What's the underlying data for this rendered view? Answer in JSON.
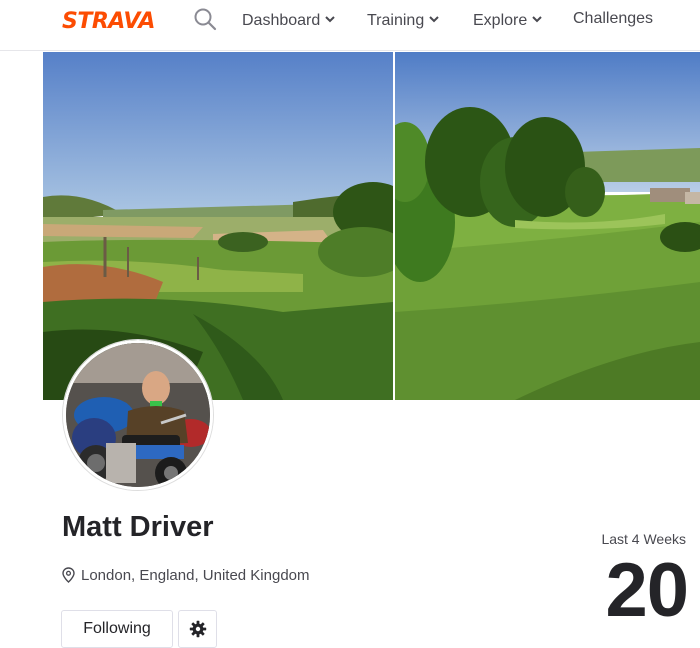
{
  "brand": {
    "logo_text": "STRAVA",
    "accent_color": "#fc4c02"
  },
  "nav": {
    "search_icon": "search-icon",
    "items": [
      {
        "label": "Dashboard",
        "has_dropdown": true
      },
      {
        "label": "Training",
        "has_dropdown": true
      },
      {
        "label": "Explore",
        "has_dropdown": true
      },
      {
        "label": "Challenges",
        "has_dropdown": false
      }
    ]
  },
  "profile": {
    "name": "Matt Driver",
    "location": "London, England, United Kingdom",
    "location_icon": "location-pin-icon",
    "follow_button_label": "Following",
    "settings_icon": "gear-icon"
  },
  "stats": {
    "label": "Last 4 Weeks",
    "value": "20"
  }
}
